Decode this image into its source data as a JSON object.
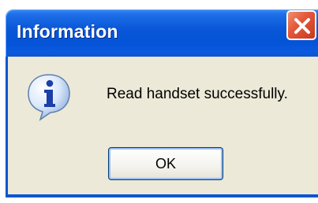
{
  "dialog": {
    "title": "Information",
    "message": "Read handset successfully.",
    "ok_label": "OK",
    "close_icon": "close-icon",
    "info_icon": "info-icon"
  },
  "colors": {
    "titlebar": "#0553d6",
    "client_background": "#ece9d8",
    "close_button": "#e4593c",
    "button_border": "#003c74"
  }
}
